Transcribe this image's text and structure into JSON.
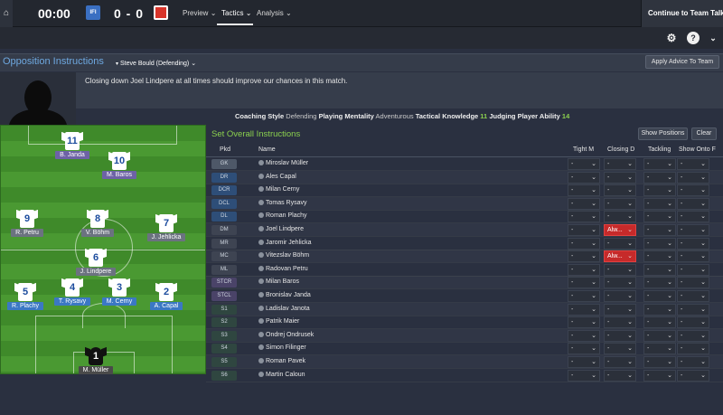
{
  "topbar": {
    "home_icon": "home-icon",
    "clock": "00:00",
    "home_crest": {
      "text": "IFI",
      "color": "#3a6fc2"
    },
    "score": "0 - 0",
    "away_crest": {
      "text": "",
      "color": "#d8342a"
    },
    "nav": [
      {
        "label": "Preview",
        "chevron": "⌄"
      },
      {
        "label": "Tactics",
        "chevron": "⌄"
      },
      {
        "label": "Analysis",
        "chevron": "⌄"
      }
    ],
    "continue_label": "Continue to Team Talk"
  },
  "subbar": {
    "settings_icon": "gear-icon",
    "help_icon": "help-icon",
    "more_icon": "chevron-down-icon",
    "help_glyph": "?",
    "more_glyph": "⌄",
    "settings_glyph": "⚙"
  },
  "header": {
    "title": "Opposition Instructions",
    "manager": "Steve Bould (Defending)",
    "manager_chevron": "⌄",
    "apply_label": "Apply Advice To Team"
  },
  "advice_message": "Closing down Joel Lindpere at all times should improve our chances in this match.",
  "infobar": {
    "coaching_style_label": "Coaching Style",
    "coaching_style_value": "Defending",
    "playing_mentality_label": "Playing Mentality",
    "playing_mentality_value": "Adventurous",
    "tactical_knowledge_label": "Tactical Knowledge",
    "tactical_knowledge_value": "11",
    "judging_player_label": "Judging Player Ability",
    "judging_player_value": "14"
  },
  "pitch_players": [
    {
      "num": "11",
      "name": "B. Janda",
      "tag": "purple"
    },
    {
      "num": "10",
      "name": "M. Baros",
      "tag": "purple"
    },
    {
      "num": "9",
      "name": "R. Petru",
      "tag": "grey"
    },
    {
      "num": "8",
      "name": "V. Böhm",
      "tag": "grey"
    },
    {
      "num": "7",
      "name": "J. Jehlicka",
      "tag": "grey"
    },
    {
      "num": "6",
      "name": "J. Lindpere",
      "tag": "grey"
    },
    {
      "num": "5",
      "name": "R. Plachy",
      "tag": "blue"
    },
    {
      "num": "4",
      "name": "T. Rysavy",
      "tag": "blue"
    },
    {
      "num": "3",
      "name": "M. Cerny",
      "tag": "blue"
    },
    {
      "num": "2",
      "name": "A. Capal",
      "tag": "blue"
    },
    {
      "num": "1",
      "name": "M. Müller",
      "tag": "dark"
    }
  ],
  "table": {
    "title": "Set Overall Instructions",
    "show_positions_label": "Show Positions",
    "clear_label": "Clear",
    "columns": {
      "pkd": "Pkd",
      "name": "Name",
      "tight": "Tight M",
      "closing": "Closing D",
      "tackling": "Tackling",
      "show_onto": "Show Onto F"
    },
    "dash": "-",
    "chevron": "⌄",
    "rows": [
      {
        "pos": "GK",
        "name": "Miroslav Müller",
        "closing": "-"
      },
      {
        "pos": "DR",
        "name": "Ales Capal",
        "closing": "-"
      },
      {
        "pos": "DCR",
        "name": "Milan Cerny",
        "closing": "-"
      },
      {
        "pos": "DCL",
        "name": "Tomas Rysavy",
        "closing": "-"
      },
      {
        "pos": "DL",
        "name": "Roman Plachy",
        "closing": "-"
      },
      {
        "pos": "DM",
        "name": "Joel Lindpere",
        "closing": "Alw..."
      },
      {
        "pos": "MR",
        "name": "Jaromir Jehlicka",
        "closing": "-"
      },
      {
        "pos": "MC",
        "name": "Vitezslav Böhm",
        "closing": "Alw..."
      },
      {
        "pos": "ML",
        "name": "Radovan Petru",
        "closing": "-"
      },
      {
        "pos": "STCR",
        "name": "Milan Baros",
        "closing": "-"
      },
      {
        "pos": "STCL",
        "name": "Bronislav Janda",
        "closing": "-"
      },
      {
        "pos": "S1",
        "name": "Ladislav Janota",
        "closing": "-"
      },
      {
        "pos": "S2",
        "name": "Patrik Maier",
        "closing": "-"
      },
      {
        "pos": "S3",
        "name": "Ondrej Ondrusek",
        "closing": "-"
      },
      {
        "pos": "S4",
        "name": "Simon Filinger",
        "closing": "-"
      },
      {
        "pos": "S5",
        "name": "Roman Pavek",
        "closing": "-"
      },
      {
        "pos": "S6",
        "name": "Martin Caloun",
        "closing": "-"
      }
    ]
  },
  "colors": {
    "accent_blue": "#6ea8e0",
    "accent_green": "#8bd04e",
    "alert_red": "#c62a2a"
  }
}
